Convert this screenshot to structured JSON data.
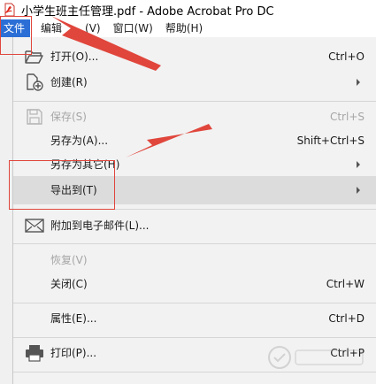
{
  "window": {
    "title": "小学生班主任管理.pdf - Adobe Acrobat Pro DC",
    "icon": "acrobat-pdf-icon"
  },
  "menubar": {
    "items": [
      {
        "label": "文件",
        "active": true
      },
      {
        "label": "编辑"
      },
      {
        "label": "(V)"
      },
      {
        "label": "窗口(W)"
      },
      {
        "label": "帮助(H)"
      }
    ]
  },
  "file_menu": {
    "items": [
      {
        "label": "打开(O)...",
        "shortcut": "Ctrl+O",
        "icon": "folder-open-icon"
      },
      {
        "label": "创建(R)",
        "icon": "create-pdf-icon",
        "submenu": true
      },
      {
        "label": "保存(S)",
        "shortcut": "Ctrl+S",
        "icon": "save-icon",
        "disabled": true
      },
      {
        "label": "另存为(A)...",
        "shortcut": "Shift+Ctrl+S"
      },
      {
        "label": "另存为其它(H)",
        "submenu": true
      },
      {
        "label": "导出到(T)",
        "submenu": true,
        "highlight": true
      },
      {
        "label": "附加到电子邮件(L)...",
        "icon": "email-icon"
      },
      {
        "label": "恢复(V)",
        "disabled": true
      },
      {
        "label": "关闭(C)",
        "shortcut": "Ctrl+W"
      },
      {
        "label": "属性(E)...",
        "shortcut": "Ctrl+D"
      },
      {
        "label": "打印(P)...",
        "shortcut": "Ctrl+P",
        "icon": "printer-icon"
      }
    ]
  },
  "colors": {
    "menu_active": "#2b6fd6",
    "annotation_red": "#e0463c",
    "disabled_text": "#a6a6a6"
  }
}
